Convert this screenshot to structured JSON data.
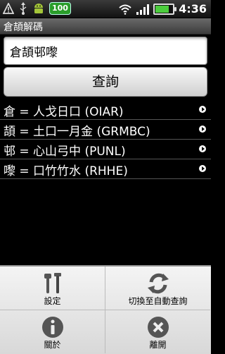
{
  "status_bar": {
    "badge": "100",
    "time": "4:36",
    "battery_level": 0.8
  },
  "titlebar": {
    "title": "倉頡解碼"
  },
  "input": {
    "value": "倉頡邨嚟"
  },
  "query_button": {
    "label": "查詢"
  },
  "results": [
    {
      "text": "倉 = 人戈日口 (OIAR)"
    },
    {
      "text": "頡 = 土口一月金 (GRMBC)"
    },
    {
      "text": "邨 = 心山弓中 (PUNL)"
    },
    {
      "text": "嚟 = 口竹竹水 (RHHE)"
    }
  ],
  "menu": {
    "settings": {
      "label": "設定",
      "icon": "wrench-screwdriver-icon"
    },
    "auto_query": {
      "label": "切換至自動查詢",
      "icon": "refresh-icon"
    },
    "about": {
      "label": "關於",
      "icon": "info-icon"
    },
    "exit": {
      "label": "離開",
      "icon": "close-icon"
    }
  }
}
